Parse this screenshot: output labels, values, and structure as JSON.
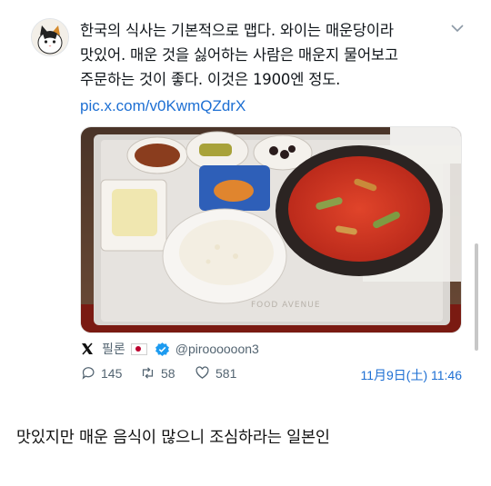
{
  "tweet": {
    "avatar_icon": "cat-avatar-icon",
    "text": "한국의 식사는 기본적으로 맵다. 와이는 매운당이라\n맛있어. 매운 것을 싫어하는 사람은 매운지 물어보고\n주문하는 것이 좋다. 이것은 1900엔 정도.",
    "link": "pic.x.com/v0KwmQZdrX",
    "menu_icon": "chevron-down-icon",
    "photo": {
      "subject": "food-tray-photo",
      "tray_print": "FOOD AVENUE"
    }
  },
  "source": {
    "logo_icon": "x-logo-icon",
    "name": "필론",
    "flag_icon": "japan-flag-icon",
    "verified_icon": "verified-badge-icon",
    "handle": "@piroooooon3"
  },
  "actions": {
    "replies": "145",
    "retweets": "58",
    "likes": "581",
    "timestamp": "11月9日(土) 11:46"
  },
  "caption": "맛있지만 매운 음식이 많으니 조심하라는 일본인",
  "colors": {
    "link": "#1d6fd3",
    "meta_text": "#536471",
    "verified": "#1d9bf0"
  }
}
